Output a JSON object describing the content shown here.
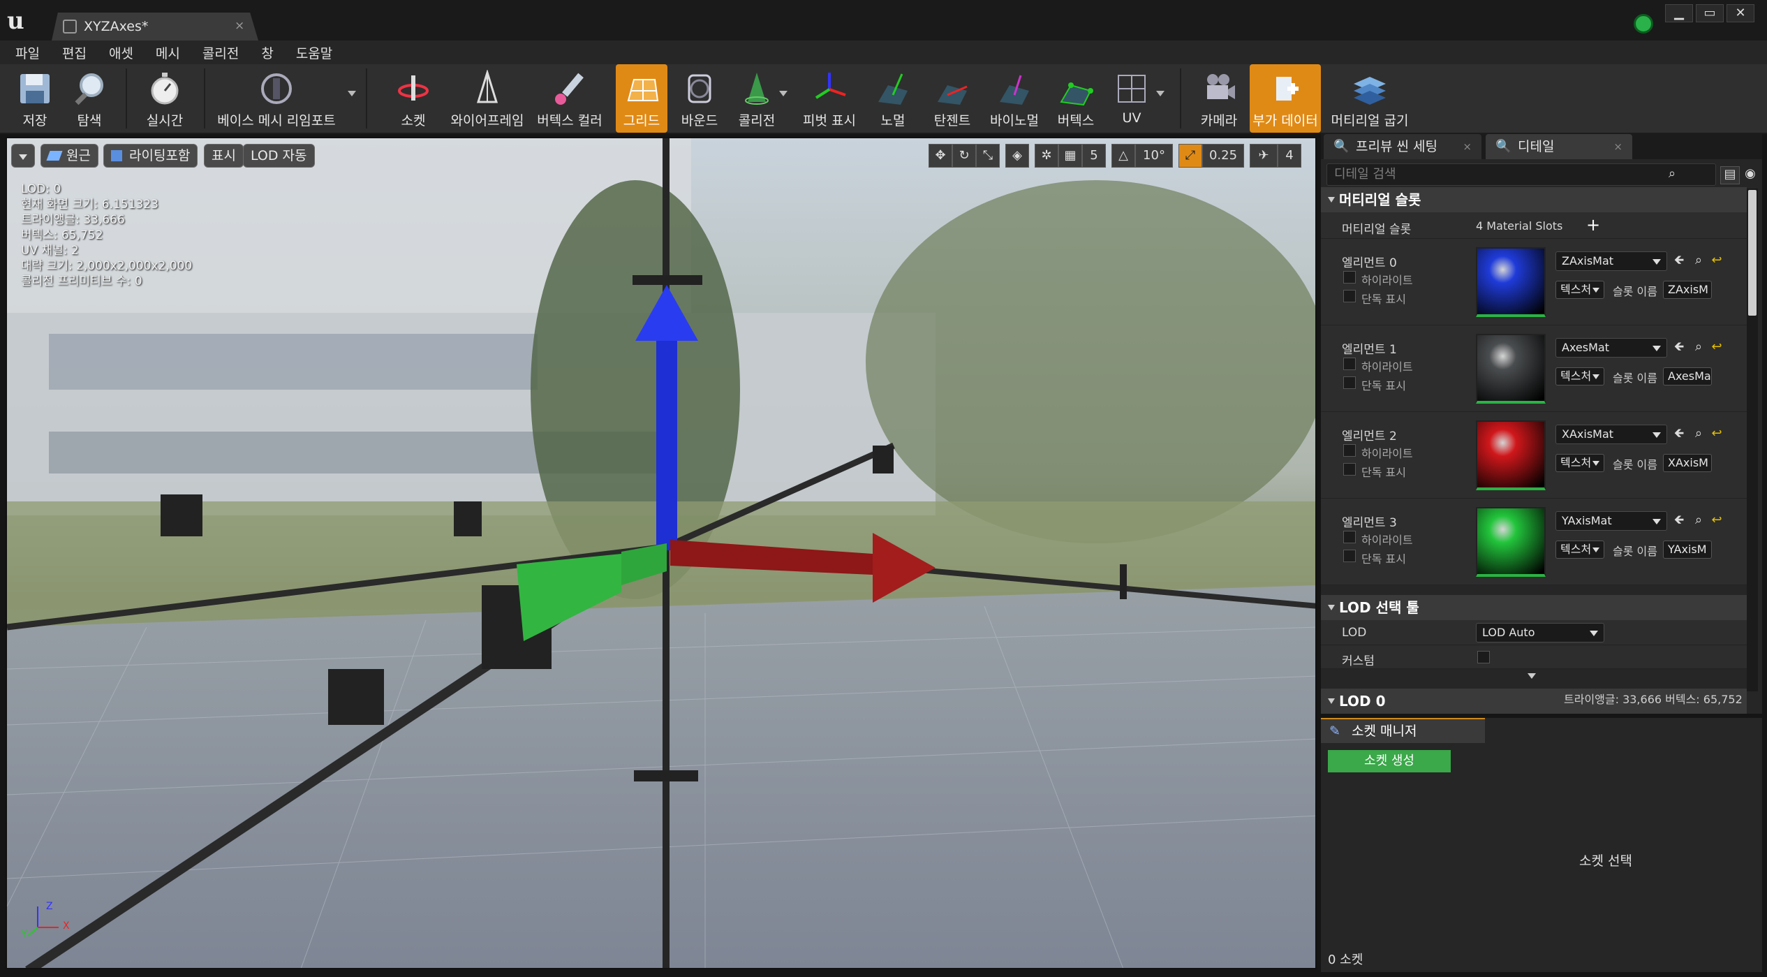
{
  "app": {
    "tab_title": "XYZAxes*",
    "tab_close": "×",
    "window_buttons": [
      "▁",
      "▭",
      "✕"
    ]
  },
  "menu": [
    "파일",
    "편집",
    "애셋",
    "메시",
    "콜리전",
    "창",
    "도움말"
  ],
  "toolbar": {
    "save": "저장",
    "browse": "탐색",
    "realtime": "실시간",
    "reimport": "베이스 메시 리임포트",
    "socket": "소켓",
    "wireframe": "와이어프레임",
    "vertex_color": "버텍스 컬러",
    "grid": "그리드",
    "bounds": "바운드",
    "collision": "콜리전",
    "pivot": "피벗 표시",
    "normal": "노멀",
    "tangent": "탄젠트",
    "binormal": "바이노멀",
    "vertex": "버텍스",
    "uv": "UV",
    "camera": "카메라",
    "additional_data": "부가 데이터",
    "bake_material": "머티리얼 굽기"
  },
  "viewport": {
    "perspective": "원근",
    "lit": "라이팅포함",
    "show": "표시",
    "lod_auto": "LOD 자동",
    "stats": [
      "LOD:  0",
      "현재 화면 크기: 6.151323",
      "트라이앵글: 33,666",
      "버텍스: 65,752",
      "UV 채널:  2",
      "대략 크기: 2,000x2,000x2,000",
      "콜리전 프리미티브 수: 0"
    ],
    "grid_snap": "5",
    "rot_snap": "10°",
    "scale_snap": "0.25",
    "cam_speed": "4",
    "axis_labels": {
      "x": "X",
      "y": "Y",
      "z": "Z"
    }
  },
  "details": {
    "tab_preview": "프리뷰 씬 세팅",
    "tab_details": "디테일",
    "tab_close": "×",
    "search_placeholder": "디테일 검색",
    "material_slots_header": "머티리얼 슬롯",
    "material_slots_label": "머티리얼 슬롯",
    "material_slots_value": "4 Material Slots",
    "highlight": "하이라이트",
    "isolate": "단독 표시",
    "texture_btn": "텍스처",
    "slot_name_label": "슬롯 이름",
    "elements": [
      {
        "label": "엘리먼트 0",
        "material": "ZAxisMat",
        "slot_name": "ZAxisM",
        "color": "#1f3bd9"
      },
      {
        "label": "엘리먼트 1",
        "material": "AxesMat",
        "slot_name": "AxesMa",
        "color": "#4a4d4f"
      },
      {
        "label": "엘리먼트 2",
        "material": "XAxisMat",
        "slot_name": "XAxisM",
        "color": "#d0171b"
      },
      {
        "label": "엘리먼트 3",
        "material": "YAxisMat",
        "slot_name": "YAxisM",
        "color": "#22c43b"
      }
    ],
    "lod_header": "LOD 선택 툴",
    "lod_label": "LOD",
    "lod_value": "LOD Auto",
    "custom_label": "커스텀",
    "lod0_header": "LOD 0",
    "lod0_stats": "트라이앵글: 33,666   버텍스: 65,752"
  },
  "sockets": {
    "tab": "소켓 매니저",
    "create": "소켓 생성",
    "select": "소켓 선택",
    "count": "0 소켓"
  },
  "colors": {
    "accent": "#e08a16",
    "create_btn": "#3ba84a"
  }
}
